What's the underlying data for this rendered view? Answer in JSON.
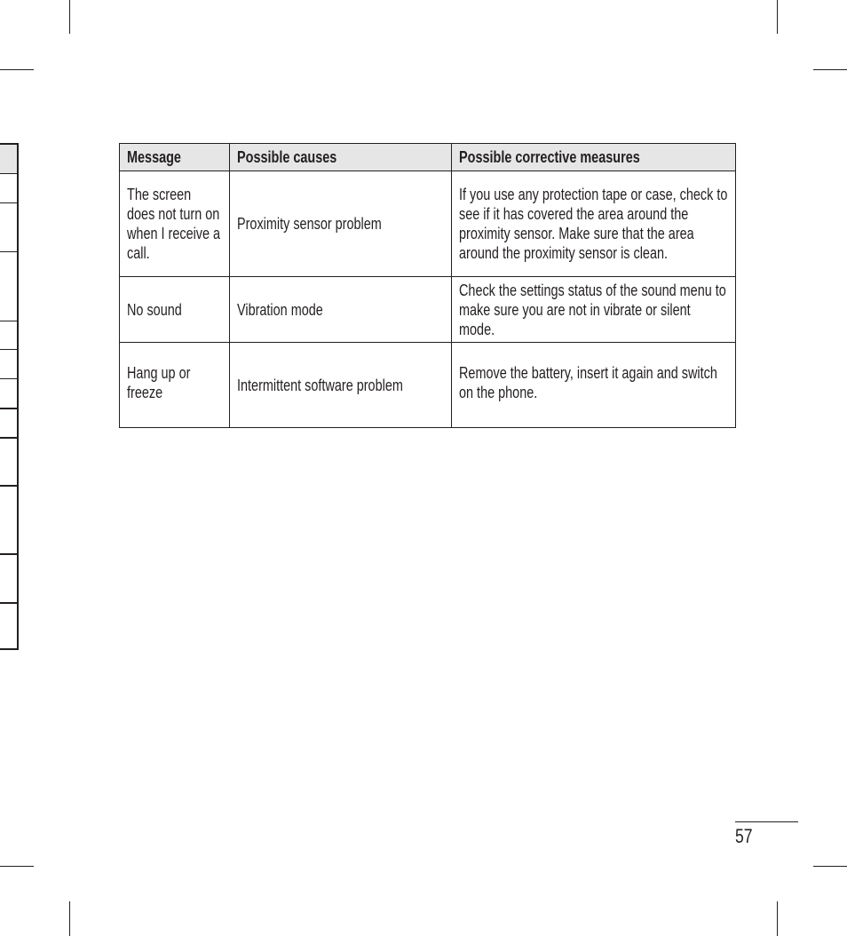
{
  "table": {
    "headers": [
      "Message",
      "Possible causes",
      "Possible corrective measures"
    ],
    "rows": [
      {
        "message": "The screen does not turn on when I receive a call.",
        "cause": "Proximity sensor problem",
        "measure": "If you use any protection tape or case, check to see if it has covered the area around the proximity sensor. Make sure that the area around the proximity sensor is clean."
      },
      {
        "message": "No sound",
        "cause": "Vibration mode",
        "measure": "Check the settings status of the sound menu to make sure you are not in vibrate or silent mode."
      },
      {
        "message": "Hang up or freeze",
        "cause": "Intermittent software problem",
        "measure": "Remove the battery, insert it again and switch on the phone."
      }
    ]
  },
  "page_number": "57",
  "colors": {
    "text": "#231f20",
    "header_bg": "#e6e6e6"
  }
}
